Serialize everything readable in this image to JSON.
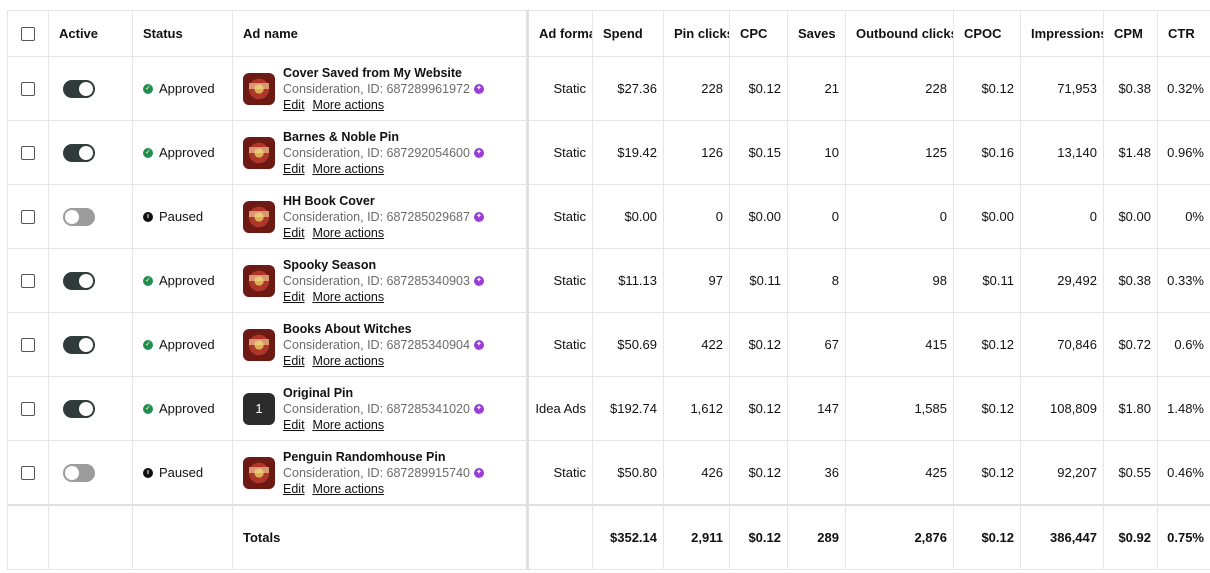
{
  "columns": {
    "active": "Active",
    "status": "Status",
    "ad_name": "Ad name",
    "ad_format": "Ad format",
    "spend": "Spend",
    "pin_clicks": "Pin clicks",
    "cpc": "CPC",
    "saves": "Saves",
    "outbound_clicks": "Outbound clicks",
    "cpoc": "CPOC",
    "impressions": "Impressions",
    "cpm": "CPM",
    "ctr": "CTR"
  },
  "links": {
    "edit": "Edit",
    "more_actions": "More actions"
  },
  "colors": {
    "approved": "#1f8f4e",
    "paused": "#111111",
    "toggle_on": "#2f3b3b",
    "toggle_off": "#9c9c9c",
    "badge": "#9b3fd4"
  },
  "rows": [
    {
      "active": true,
      "status": "Approved",
      "thumb": "book",
      "name": "Cover Saved from My Website",
      "sub": "Consideration, ID: 687289961972",
      "format": "Static",
      "spend": "$27.36",
      "pin_clicks": "228",
      "cpc": "$0.12",
      "saves": "21",
      "outbound_clicks": "228",
      "cpoc": "$0.12",
      "impressions": "71,953",
      "cpm": "$0.38",
      "ctr": "0.32%"
    },
    {
      "active": true,
      "status": "Approved",
      "thumb": "book",
      "name": "Barnes & Noble Pin",
      "sub": "Consideration, ID: 687292054600",
      "format": "Static",
      "spend": "$19.42",
      "pin_clicks": "126",
      "cpc": "$0.15",
      "saves": "10",
      "outbound_clicks": "125",
      "cpoc": "$0.16",
      "impressions": "13,140",
      "cpm": "$1.48",
      "ctr": "0.96%"
    },
    {
      "active": false,
      "status": "Paused",
      "thumb": "book",
      "name": "HH Book Cover",
      "sub": "Consideration, ID: 687285029687",
      "format": "Static",
      "spend": "$0.00",
      "pin_clicks": "0",
      "cpc": "$0.00",
      "saves": "0",
      "outbound_clicks": "0",
      "cpoc": "$0.00",
      "impressions": "0",
      "cpm": "$0.00",
      "ctr": "0%"
    },
    {
      "active": true,
      "status": "Approved",
      "thumb": "book",
      "name": "Spooky Season",
      "sub": "Consideration, ID: 687285340903",
      "format": "Static",
      "spend": "$11.13",
      "pin_clicks": "97",
      "cpc": "$0.11",
      "saves": "8",
      "outbound_clicks": "98",
      "cpoc": "$0.11",
      "impressions": "29,492",
      "cpm": "$0.38",
      "ctr": "0.33%"
    },
    {
      "active": true,
      "status": "Approved",
      "thumb": "book",
      "name": "Books About Witches",
      "sub": "Consideration, ID: 687285340904",
      "format": "Static",
      "spend": "$50.69",
      "pin_clicks": "422",
      "cpc": "$0.12",
      "saves": "67",
      "outbound_clicks": "415",
      "cpoc": "$0.12",
      "impressions": "70,846",
      "cpm": "$0.72",
      "ctr": "0.6%"
    },
    {
      "active": true,
      "status": "Approved",
      "thumb": "number",
      "thumb_text": "1",
      "name": "Original Pin",
      "sub": "Consideration, ID: 687285341020",
      "format": "Idea Ads",
      "spend": "$192.74",
      "pin_clicks": "1,612",
      "cpc": "$0.12",
      "saves": "147",
      "outbound_clicks": "1,585",
      "cpoc": "$0.12",
      "impressions": "108,809",
      "cpm": "$1.80",
      "ctr": "1.48%"
    },
    {
      "active": false,
      "status": "Paused",
      "thumb": "book",
      "name": "Penguin Randomhouse Pin",
      "sub": "Consideration, ID: 687289915740",
      "format": "Static",
      "spend": "$50.80",
      "pin_clicks": "426",
      "cpc": "$0.12",
      "saves": "36",
      "outbound_clicks": "425",
      "cpoc": "$0.12",
      "impressions": "92,207",
      "cpm": "$0.55",
      "ctr": "0.46%"
    }
  ],
  "totals": {
    "label": "Totals",
    "spend": "$352.14",
    "pin_clicks": "2,911",
    "cpc": "$0.12",
    "saves": "289",
    "outbound_clicks": "2,876",
    "cpoc": "$0.12",
    "impressions": "386,447",
    "cpm": "$0.92",
    "ctr": "0.75%"
  },
  "icons": {
    "approved": "check-circle-icon",
    "paused": "pause-circle-icon",
    "badge": "promoted-badge-icon"
  }
}
